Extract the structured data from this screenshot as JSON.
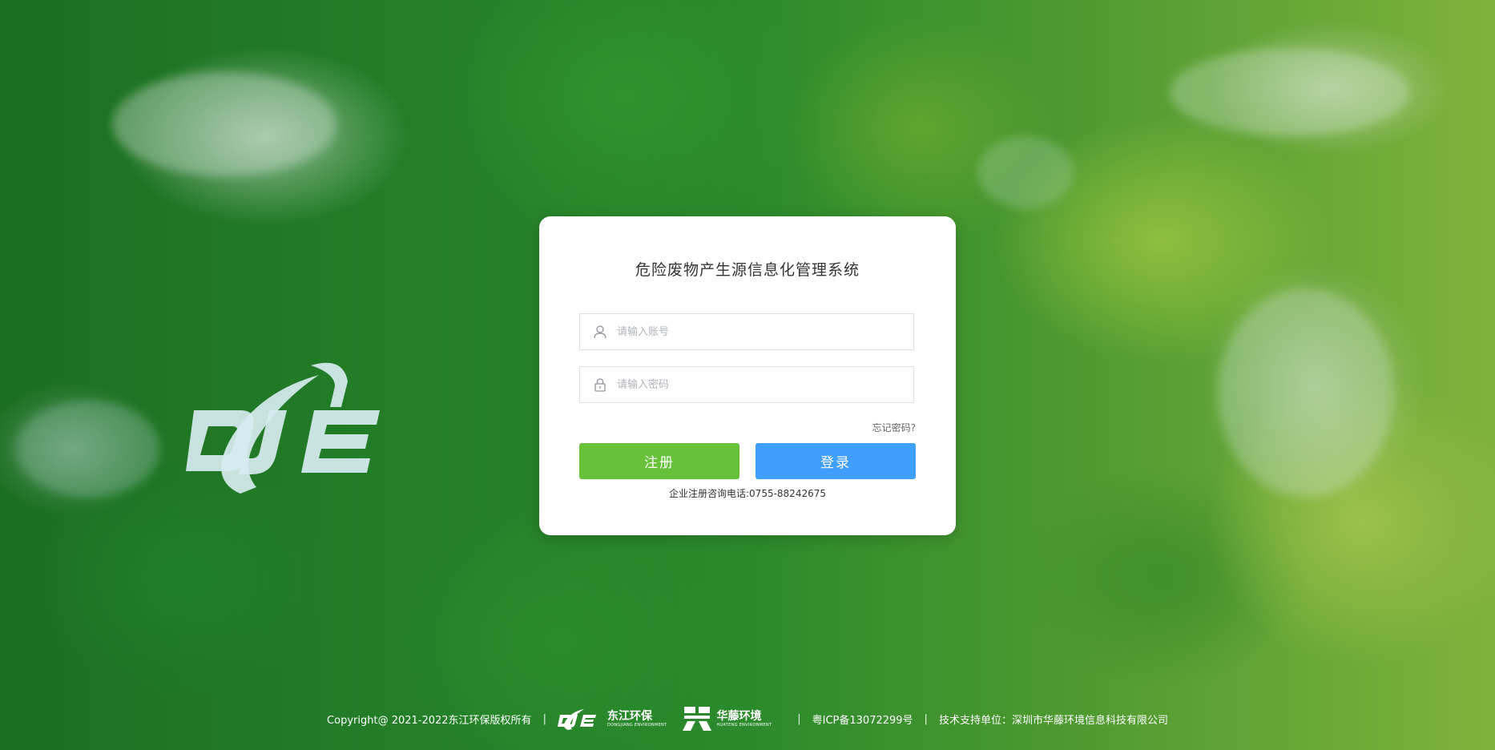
{
  "login": {
    "title": "危险废物产生源信息化管理系统",
    "account_placeholder": "请输入账号",
    "password_placeholder": "请输入密码",
    "forgot_label": "忘记密码?",
    "register_label": "注册",
    "login_label": "登录",
    "hotline": "企业注册咨询电话:0755-88242675"
  },
  "footer": {
    "copyright": "Copyright@ 2021-2022东江环保版权所有",
    "brand1_cn": "东江环保",
    "brand1_en": "DONGJIANG ENVIRONMENT",
    "brand2_cn": "华藤环境",
    "brand2_en": "HUATENG ENVIRONMENT",
    "icp": "粤ICP备13072299号",
    "support": "技术支持单位：深圳市华藤环境信息科技有限公司",
    "separator": "|"
  },
  "colors": {
    "register": "#67c23a",
    "login": "#409eff"
  },
  "icons": {
    "account": "user-icon",
    "password": "lock-icon"
  }
}
